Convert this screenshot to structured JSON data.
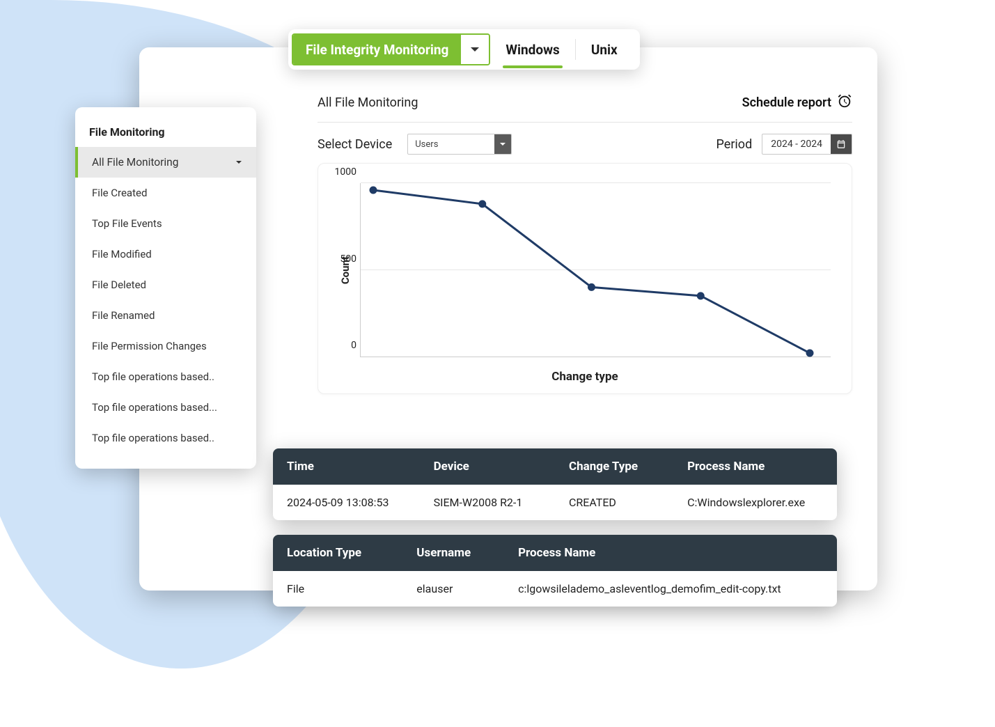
{
  "topbar": {
    "category_label": "File Integrity  Monitoring",
    "tabs": [
      {
        "label": "Windows",
        "active": true
      },
      {
        "label": "Unix",
        "active": false
      }
    ]
  },
  "header": {
    "page_title": "All File Monitoring",
    "schedule_label": "Schedule report"
  },
  "filters": {
    "device_label": "Select Device",
    "device_value": "Users",
    "period_label": "Period",
    "period_value": "2024 - 2024"
  },
  "sidebar": {
    "title": "File Monitoring",
    "items": [
      {
        "label": "All File Monitoring",
        "active": true,
        "has_caret": true
      },
      {
        "label": "File Created"
      },
      {
        "label": "Top File Events"
      },
      {
        "label": "File Modified"
      },
      {
        "label": "File Deleted"
      },
      {
        "label": "File Renamed"
      },
      {
        "label": "File Permission Changes"
      },
      {
        "label": "Top file operations based.."
      },
      {
        "label": "Top file operations based..."
      },
      {
        "label": "Top file operations based.."
      }
    ]
  },
  "chart_data": {
    "type": "line",
    "ylabel": "Count",
    "xlabel": "Change type",
    "ylim": [
      0,
      1000
    ],
    "yticks": [
      0,
      500,
      1000
    ],
    "x": [
      1,
      2,
      3,
      4,
      5
    ],
    "values": [
      960,
      880,
      400,
      350,
      20
    ]
  },
  "table1": {
    "headers": [
      "Time",
      "Device",
      "Change Type",
      "Process Name"
    ],
    "rows": [
      [
        "2024-05-09 13:08:53",
        "SIEM-W2008 R2-1",
        "CREATED",
        "C:Windowslexplorer.exe"
      ]
    ]
  },
  "table2": {
    "headers": [
      "Location Type",
      "Username",
      "Process Name"
    ],
    "rows": [
      [
        "File",
        "elauser",
        "c:lgowsilelademo_asleventlog_demofim_edit-copy.txt"
      ]
    ]
  }
}
